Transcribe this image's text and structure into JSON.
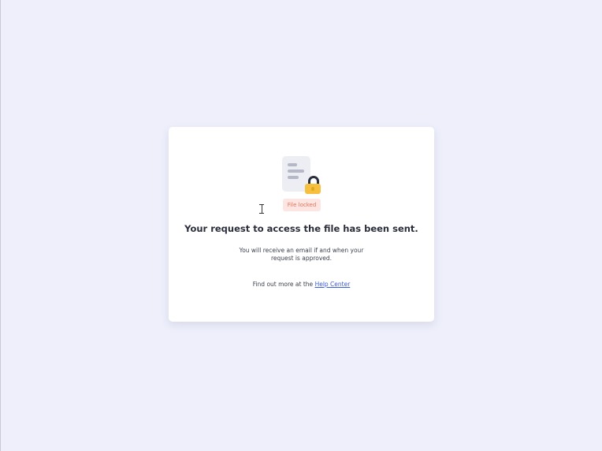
{
  "dialog": {
    "badge": "File locked",
    "title": "Your request to access the file has been sent.",
    "message": "You will receive an email if and when your request is approved.",
    "help_prefix": "Find out more at the",
    "help_link": "Help Center"
  },
  "icons": {
    "main": "file-locked-icon",
    "lock": "padlock-icon"
  },
  "colors": {
    "background": "#eeeffb",
    "card": "#ffffff",
    "badge_bg": "#fde6e1",
    "badge_text": "#e2735f",
    "link": "#3b5bd6",
    "lock": "#f6c03e"
  }
}
